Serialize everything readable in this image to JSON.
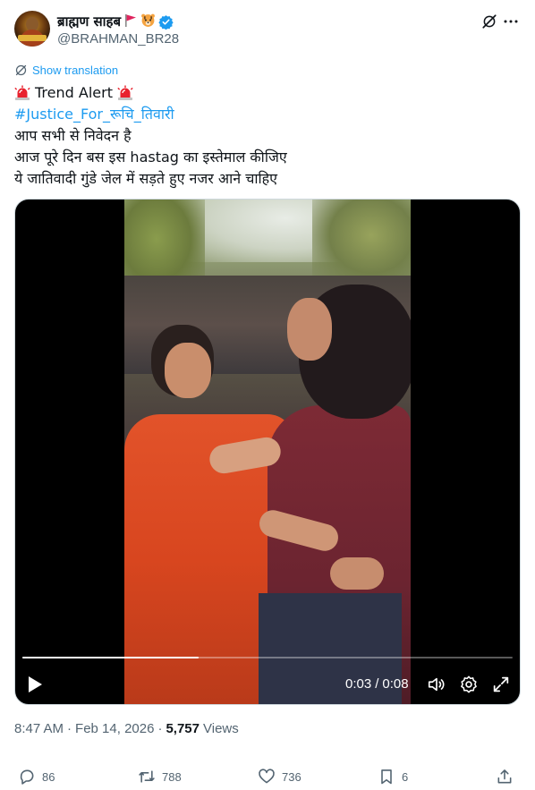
{
  "author": {
    "display_name": "ब्राह्मण साहब",
    "handle": "@BRAHMAN_BR28",
    "avatar_icon": "profile-avatar",
    "badges": [
      "red-flag-emoji",
      "tiger-face-emoji",
      "verified-badge-icon"
    ],
    "verified_color": "#1d9bf0"
  },
  "header_actions": {
    "grok_icon": "grok-icon",
    "more_icon": "more-dots-icon"
  },
  "translation": {
    "label": "Show translation"
  },
  "tweet": {
    "line1_text": "Trend Alert",
    "line1_emoji": "rotating-light-emoji",
    "hashtag": "#Justice_For_रूचि_तिवारी",
    "line3": "आप सभी से निवेदन है",
    "line4": "आज पूरे दिन बस इस hastag का इस्तेमाल कीजिए",
    "line5": "ये जातिवादी गुंडे जेल में सड़ते हुए नजर आने चाहिए"
  },
  "video": {
    "current_time": "0:03",
    "separator": "/",
    "duration": "0:08",
    "progress_fraction": 0.36,
    "controls": [
      "play-icon",
      "volume-icon",
      "settings-icon",
      "fullscreen-icon"
    ]
  },
  "meta": {
    "time": "8:47 AM",
    "dot1": "·",
    "date": "Feb 14, 2026",
    "dot2": "·",
    "views_count": "5,757",
    "views_label": "Views"
  },
  "actions": {
    "replies": "86",
    "reposts": "788",
    "likes": "736",
    "bookmarks": "6"
  },
  "colors": {
    "accent": "#1d9bf0",
    "text": "#0f1419",
    "muted": "#536471"
  }
}
